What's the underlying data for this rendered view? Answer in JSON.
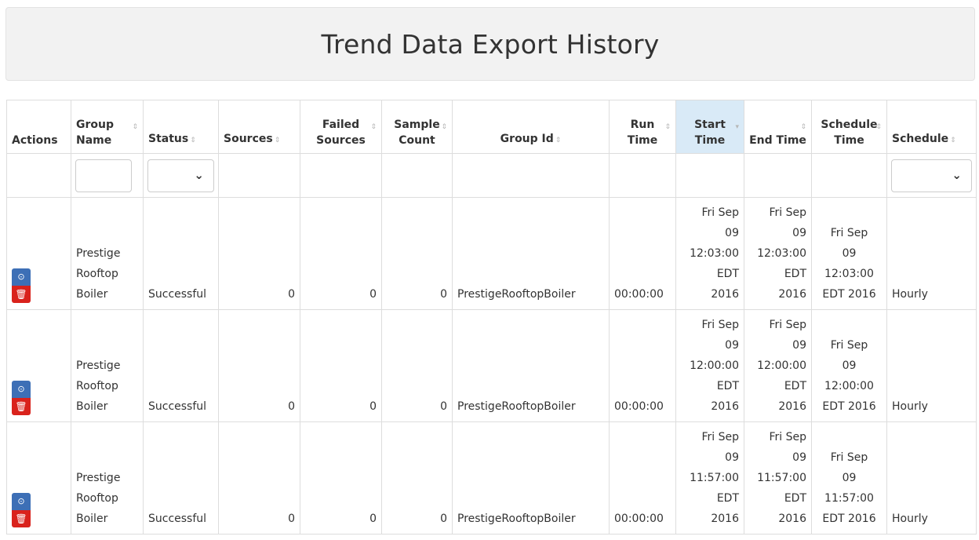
{
  "page": {
    "title": "Trend Data Export History"
  },
  "columns": [
    {
      "key": "actions",
      "label": "Actions"
    },
    {
      "key": "group_name",
      "label": "Group Name"
    },
    {
      "key": "status",
      "label": "Status"
    },
    {
      "key": "sources",
      "label": "Sources"
    },
    {
      "key": "failed_sources",
      "label": "Failed Sources"
    },
    {
      "key": "sample_count",
      "label": "Sample Count"
    },
    {
      "key": "group_id",
      "label": "Group Id"
    },
    {
      "key": "run_time",
      "label": "Run Time"
    },
    {
      "key": "start_time",
      "label": "Start Time"
    },
    {
      "key": "end_time",
      "label": "End Time"
    },
    {
      "key": "schedule_time",
      "label": "Schedule Time"
    },
    {
      "key": "schedule",
      "label": "Schedule"
    }
  ],
  "sort_icon": "⇕",
  "sort_desc_icon": "▾",
  "filters": {
    "chevron": "⌄"
  },
  "icons": {
    "view": "⊙",
    "delete": "🗑"
  },
  "colors": {
    "view_button": "#3d6fb6",
    "delete_button": "#d9221c",
    "success_text": "#3c8d3c",
    "sorted_header": "#d9eaf7"
  },
  "rows": [
    {
      "group_name": [
        "Prestige",
        "Rooftop",
        "Boiler"
      ],
      "status": "Successful",
      "sources": "0",
      "failed_sources": "0",
      "sample_count": "0",
      "group_id": "PrestigeRooftopBoiler",
      "run_time": "00:00:00",
      "start_time": [
        "Fri Sep",
        "09",
        "12:03:00",
        "EDT",
        "2016"
      ],
      "end_time": [
        "Fri Sep",
        "09",
        "12:03:00",
        "EDT",
        "2016"
      ],
      "schedule_time": [
        "Fri Sep",
        "09",
        "12:03:00",
        "EDT 2016"
      ],
      "schedule": "Hourly"
    },
    {
      "group_name": [
        "Prestige",
        "Rooftop",
        "Boiler"
      ],
      "status": "Successful",
      "sources": "0",
      "failed_sources": "0",
      "sample_count": "0",
      "group_id": "PrestigeRooftopBoiler",
      "run_time": "00:00:00",
      "start_time": [
        "Fri Sep",
        "09",
        "12:00:00",
        "EDT",
        "2016"
      ],
      "end_time": [
        "Fri Sep",
        "09",
        "12:00:00",
        "EDT",
        "2016"
      ],
      "schedule_time": [
        "Fri Sep",
        "09",
        "12:00:00",
        "EDT 2016"
      ],
      "schedule": "Hourly"
    },
    {
      "group_name": [
        "Prestige",
        "Rooftop",
        "Boiler"
      ],
      "status": "Successful",
      "sources": "0",
      "failed_sources": "0",
      "sample_count": "0",
      "group_id": "PrestigeRooftopBoiler",
      "run_time": "00:00:00",
      "start_time": [
        "Fri Sep",
        "09",
        "11:57:00",
        "EDT",
        "2016"
      ],
      "end_time": [
        "Fri Sep",
        "09",
        "11:57:00",
        "EDT",
        "2016"
      ],
      "schedule_time": [
        "Fri Sep",
        "09",
        "11:57:00",
        "EDT 2016"
      ],
      "schedule": "Hourly"
    }
  ]
}
